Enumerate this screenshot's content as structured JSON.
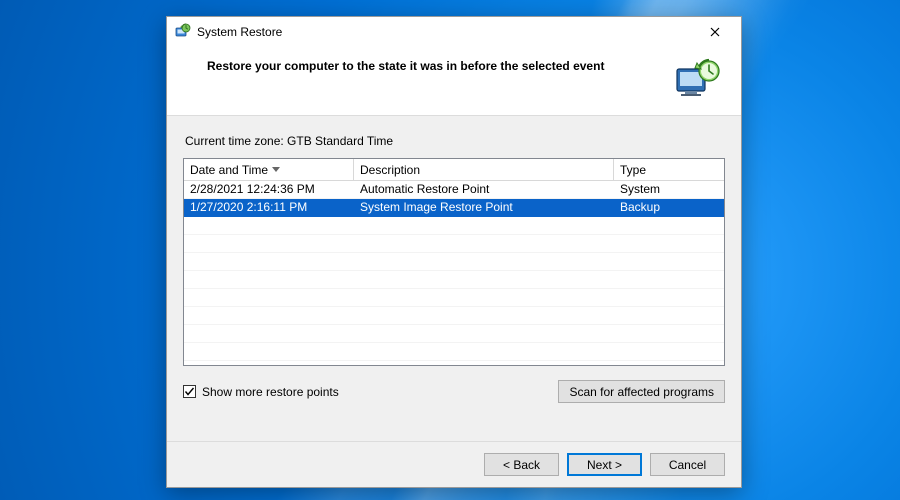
{
  "window": {
    "title": "System Restore"
  },
  "header": {
    "heading": "Restore your computer to the state it was in before the selected event"
  },
  "timezone": {
    "label": "Current time zone: GTB Standard Time"
  },
  "list": {
    "columns": {
      "datetime": "Date and Time",
      "description": "Description",
      "type": "Type"
    },
    "sort_column": "datetime",
    "rows": [
      {
        "datetime": "2/28/2021 12:24:36 PM",
        "description": "Automatic Restore Point",
        "type": "System",
        "selected": false
      },
      {
        "datetime": "1/27/2020 2:16:11 PM",
        "description": "System Image Restore Point",
        "type": "Backup",
        "selected": true
      }
    ]
  },
  "showMore": {
    "label": "Show more restore points",
    "checked": true
  },
  "buttons": {
    "scan": "Scan for affected programs",
    "back": "< Back",
    "next": "Next >",
    "cancel": "Cancel"
  }
}
